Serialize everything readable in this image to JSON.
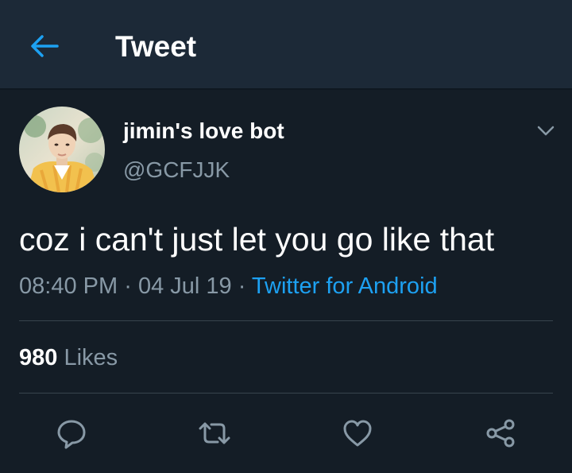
{
  "header": {
    "title": "Tweet",
    "back_icon": "arrow-left-icon",
    "accent": "#1da1f2"
  },
  "author": {
    "display_name": "jimin's love bot",
    "handle": "@GCFJJK",
    "menu_icon": "chevron-down-icon"
  },
  "tweet": {
    "text": "coz i can't just let you go like that",
    "time": "08:40 PM",
    "separator": "·",
    "date": "04 Jul 19",
    "source": "Twitter for Android"
  },
  "stats": {
    "likes_count": "980",
    "likes_label": "Likes"
  },
  "actions": [
    {
      "name": "reply",
      "icon": "reply-icon"
    },
    {
      "name": "retweet",
      "icon": "retweet-icon"
    },
    {
      "name": "like",
      "icon": "heart-icon"
    },
    {
      "name": "share",
      "icon": "share-icon"
    }
  ],
  "colors": {
    "background": "#141d26",
    "header_bg": "#1c2937",
    "secondary_text": "#8899a6",
    "link": "#1da1f2",
    "divider": "#38444d"
  }
}
